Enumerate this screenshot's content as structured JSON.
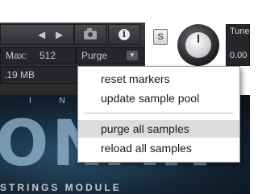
{
  "header": {
    "max_label": "Max:",
    "max_value": "512",
    "purge_label": "Purge",
    "memory_value": ".19 MB",
    "s_button_label": "S",
    "tune_label": "Tune",
    "tune_value": "0.00"
  },
  "icons": {
    "prev": "left-arrow-icon",
    "next": "right-arrow-icon",
    "camera": "camera-icon",
    "info": "info-icon",
    "dropdown": "chevron-down-icon"
  },
  "artwork": {
    "top_letters": "I N S T",
    "big_text": "ONAR",
    "subtitle": "STRINGS MODULE"
  },
  "menu": {
    "items": [
      {
        "label": "reset markers"
      },
      {
        "label": "update sample pool"
      },
      {
        "label": "purge all samples"
      },
      {
        "label": "reload all samples"
      }
    ]
  },
  "colors": {
    "menu_hover": "#dcdcdc",
    "panel_dark": "#2a2a2c"
  }
}
